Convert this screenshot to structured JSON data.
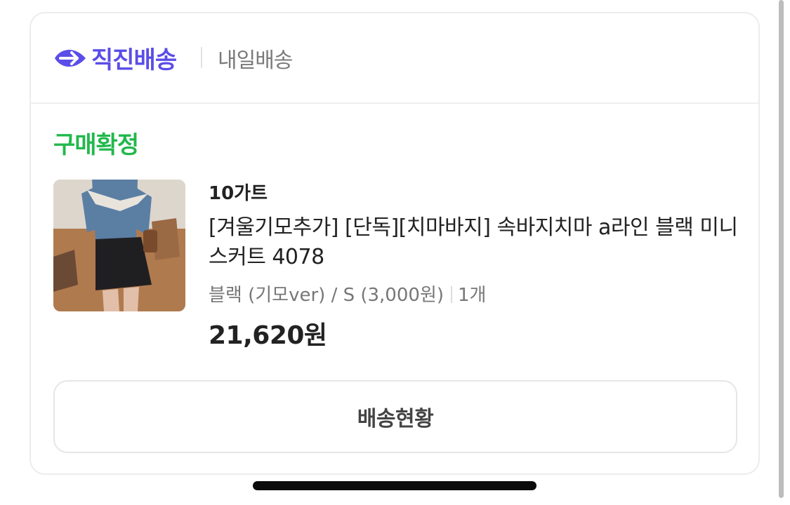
{
  "header": {
    "brand": "직진배송",
    "delivery_type": "내일배송",
    "logo_icon": "arrow-delivery-icon",
    "brand_color": "#5b4de8"
  },
  "order": {
    "status": "구매확정",
    "status_color": "#22b84c",
    "seller": "10가트",
    "product_title": "[겨울기모추가] [단독][치마바지] 속바지치마 a라인 블랙 미니 스커트 4078",
    "option": "블랙 (기모ver) / S  (3,000원)",
    "quantity": "1개",
    "price": "21,620원"
  },
  "actions": {
    "track_button": "배송현황"
  }
}
